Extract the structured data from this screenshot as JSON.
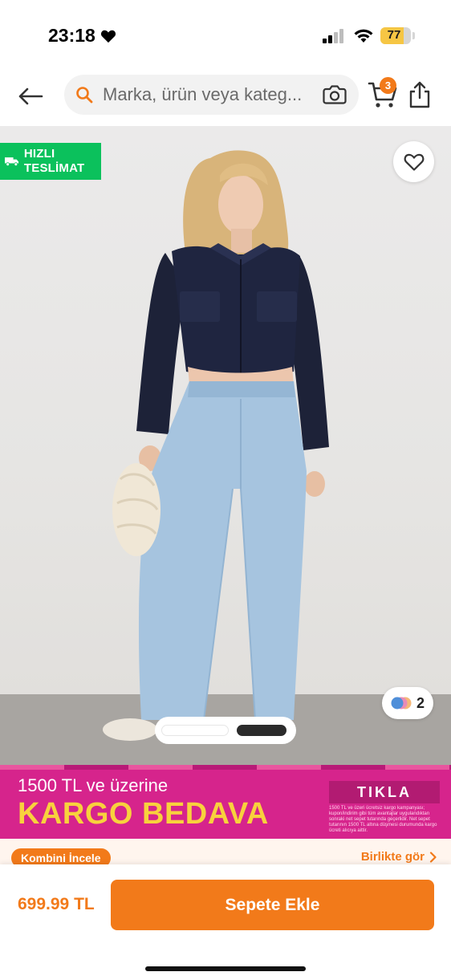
{
  "status_bar": {
    "time": "23:18",
    "battery": "77",
    "battery_level": 0.77
  },
  "header": {
    "search_placeholder": "Marka, ürün veya kateg...",
    "cart_count": "3"
  },
  "product_image": {
    "fast_delivery_badge": "HIZLI TESLİMAT",
    "variant_count": "2",
    "pager": {
      "total": 2,
      "active_index": 1
    }
  },
  "promo": {
    "line1": "1500 TL ve üzerine",
    "line2": "KARGO BEDAVA",
    "button": "TIKLA",
    "fine_print": "1500 TL ve üzeri ücretsiz kargo kampanyası; kupon/indirim gibi tüm avantajlar uygulandıktan sonraki net sepet tutarında geçerlidir. Net sepet tutarının 1500 TL altına düşmesi durumunda kargo ücreti alıcıya aittir."
  },
  "combo": {
    "button": "Kombini İncele",
    "link": "Birlikte gör"
  },
  "bottom_bar": {
    "price": "699.99 TL",
    "add_to_cart": "Sepete Ekle"
  },
  "colors": {
    "accent": "#f27a1a",
    "fast_badge": "#0bc15c",
    "promo_bg": "#d6248c",
    "promo_yellow": "#f8d13d"
  }
}
